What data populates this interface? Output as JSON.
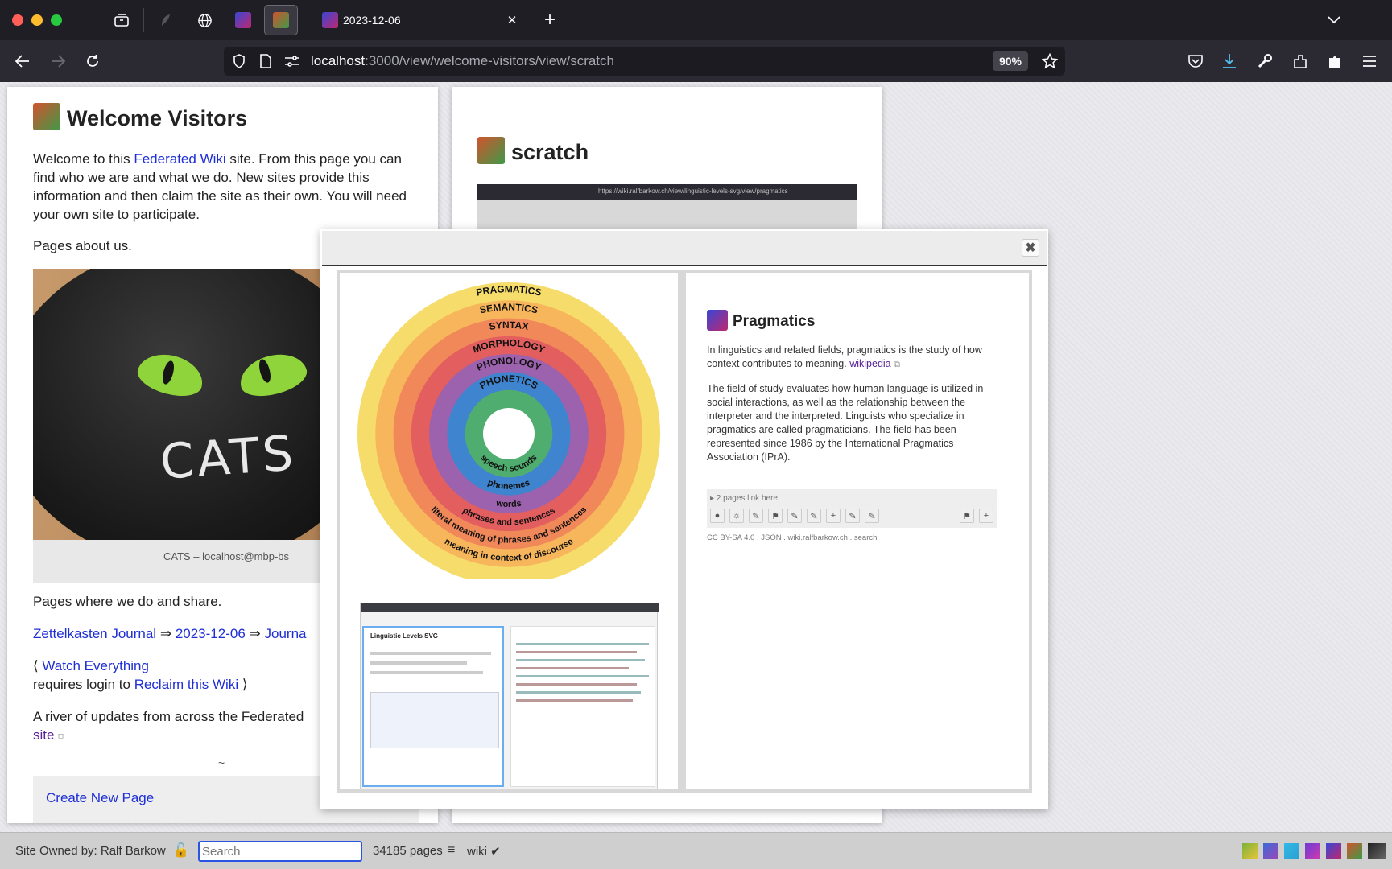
{
  "browser": {
    "active_tab_title": "2023-12-06",
    "url": {
      "host": "localhost",
      "rest": ":3000/view/welcome-visitors/view/scratch"
    },
    "zoom": "90%",
    "inner_url": "https://wiki.ralfbarkow.ch/view/linguistic-levels-svg/view/pragmatics"
  },
  "welcome": {
    "title": "Welcome Visitors",
    "intro_pre": "Welcome to this ",
    "intro_link": "Federated Wiki",
    "intro_post": " site. From this page you can find who we are and what we do. New sites provide this information and then claim the site as their own. You will need your own site to participate.",
    "pages_about": "Pages about us.",
    "image_caption": "CATS – localhost@mbp-bs",
    "image_text": "CATS",
    "pages_where": "Pages where we do and share.",
    "journal_link1": "Zettelkasten Journal",
    "arrow": "⇒",
    "journal_link2": "2023-12-06",
    "journal_link3": "Journa",
    "watch_open": "⟨",
    "watch_link": "Watch Everything",
    "requires": "requires login to",
    "reclaim_link": "Reclaim this Wiki",
    "watch_close": "⟩",
    "river_pre": "A river of updates from across the Federated",
    "river_link": "site",
    "tilde": "~",
    "create_link": "Create New Page"
  },
  "scratch": {
    "title": "scratch"
  },
  "lightbox": {
    "close": "✖",
    "rings": [
      {
        "label": "PRAGMATICS",
        "color": "#f5dc6b"
      },
      {
        "label": "SEMANTICS",
        "color": "#f7b65b"
      },
      {
        "label": "SYNTAX",
        "color": "#f0885a"
      },
      {
        "label": "MORPHOLOGY",
        "color": "#e35e5e"
      },
      {
        "label": "PHONOLOGY",
        "color": "#9c62ad"
      },
      {
        "label": "PHONETICS",
        "color": "#3f84cf"
      },
      {
        "label": "",
        "color": "#4fae6f"
      }
    ],
    "inner_labels": [
      "speech sounds",
      "phonemes",
      "words",
      "phrases and sentences",
      "literal meaning of phrases and sentences",
      "meaning in context of discourse"
    ],
    "mini_title": "Linguistic Levels SVG",
    "pragmatics": {
      "title": "Pragmatics",
      "p1": "In linguistics and related fields, pragmatics is the study of how context contributes to meaning.",
      "p1_link": "wikipedia",
      "p2": "The field of study evaluates how human language is utilized in social interactions, as well as the relationship between the interpreter and the interpreted. Linguists who specialize in pragmatics are called pragmaticians. The field has been represented since 1986 by the International Pragmatics Association (IPrA).",
      "links_here": "▸ 2 pages link here:",
      "license": "CC BY-SA 4.0",
      "footer_links": [
        "JSON",
        "wiki.ralfbarkow.ch",
        "search"
      ]
    }
  },
  "footer": {
    "owner": "Site Owned by: Ralf Barkow",
    "search_placeholder": "Search",
    "pages_count": "34185 pages",
    "menu": "≡",
    "wiki": "wiki ✔"
  }
}
